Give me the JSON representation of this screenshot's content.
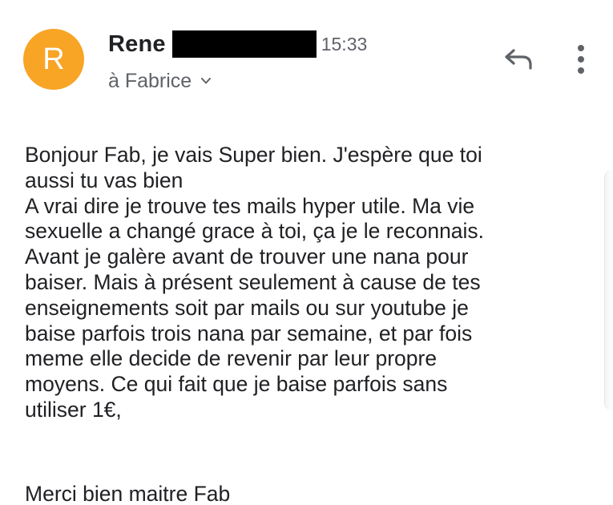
{
  "header": {
    "avatar_initial": "R",
    "avatar_color": "#f8a425",
    "sender_name": "Rene",
    "time": "15:33",
    "recipient": "à Fabrice",
    "chevron_icon": "chevron-down-icon",
    "reply_icon": "reply-icon",
    "more_icon": "more-vertical-icon"
  },
  "message": {
    "body": "Bonjour Fab, je vais Super bien. J'espère que toi\naussi tu vas bien\nA vrai dire je trouve tes mails hyper utile. Ma vie\nsexuelle a changé grace à toi, ça je le reconnais.\nAvant je galère avant de trouver une nana pour\nbaiser. Mais à présent seulement à cause de tes\nenseignements soit par mails ou sur youtube je\nbaise parfois trois nana par semaine, et par fois\nmeme elle decide de revenir par leur propre\nmoyens. Ce qui fait que je baise parfois sans\nutiliser 1€,",
    "signoff": "Merci bien maitre Fab"
  }
}
